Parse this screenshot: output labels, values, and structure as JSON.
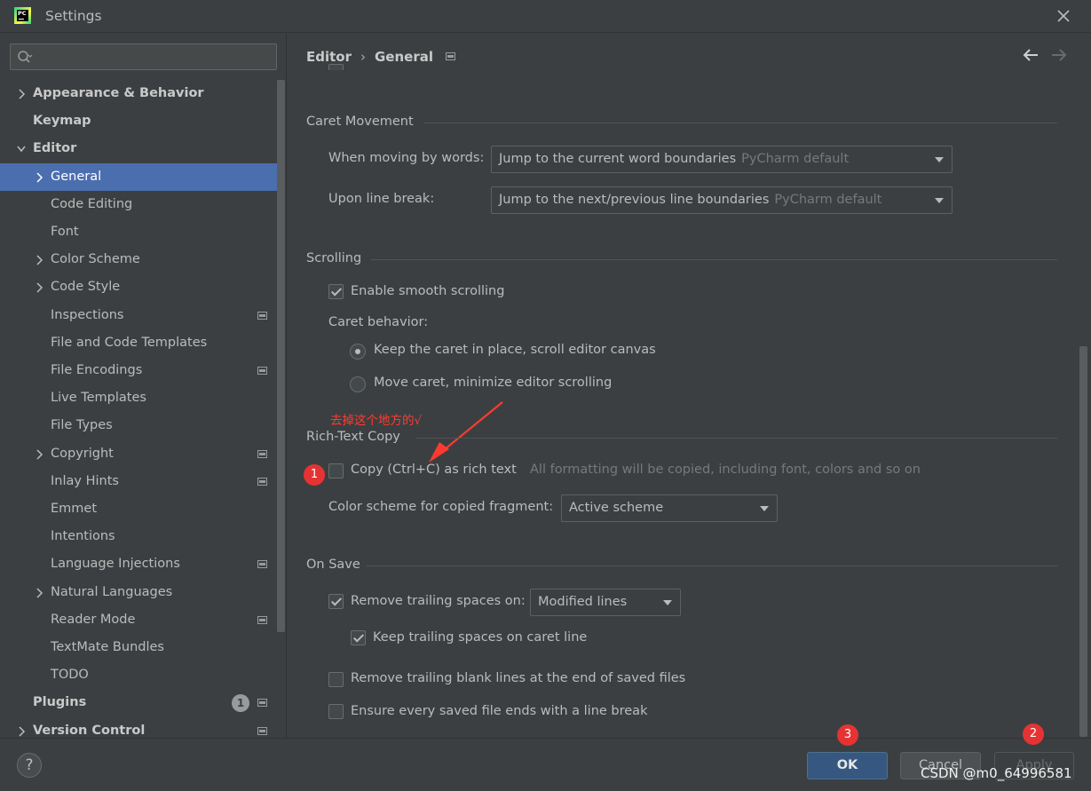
{
  "window": {
    "title": "Settings"
  },
  "search": {
    "placeholder": ""
  },
  "sidebar": {
    "items": [
      {
        "label": "Appearance & Behavior",
        "bold": true,
        "arrow": "right",
        "level": 0
      },
      {
        "label": "Keymap",
        "bold": true,
        "level": 0
      },
      {
        "label": "Editor",
        "bold": true,
        "arrow": "down",
        "level": 0
      },
      {
        "label": "General",
        "arrow": "right",
        "level": 1,
        "selected": true
      },
      {
        "label": "Code Editing",
        "level": 1
      },
      {
        "label": "Font",
        "level": 1
      },
      {
        "label": "Color Scheme",
        "arrow": "right",
        "level": 1
      },
      {
        "label": "Code Style",
        "arrow": "right",
        "level": 1
      },
      {
        "label": "Inspections",
        "level": 1,
        "project": true
      },
      {
        "label": "File and Code Templates",
        "level": 1
      },
      {
        "label": "File Encodings",
        "level": 1,
        "project": true
      },
      {
        "label": "Live Templates",
        "level": 1
      },
      {
        "label": "File Types",
        "level": 1
      },
      {
        "label": "Copyright",
        "arrow": "right",
        "level": 1,
        "project": true
      },
      {
        "label": "Inlay Hints",
        "level": 1,
        "project": true
      },
      {
        "label": "Emmet",
        "level": 1
      },
      {
        "label": "Intentions",
        "level": 1
      },
      {
        "label": "Language Injections",
        "level": 1,
        "project": true
      },
      {
        "label": "Natural Languages",
        "arrow": "right",
        "level": 1
      },
      {
        "label": "Reader Mode",
        "level": 1,
        "project": true
      },
      {
        "label": "TextMate Bundles",
        "level": 1
      },
      {
        "label": "TODO",
        "level": 1
      },
      {
        "label": "Plugins",
        "bold": true,
        "level": 0,
        "badge": "1",
        "project": true
      },
      {
        "label": "Version Control",
        "bold": true,
        "arrow": "right",
        "level": 0,
        "project": true
      }
    ]
  },
  "header": {
    "crumb1": "Editor",
    "crumb2": "General"
  },
  "caret_movement": {
    "title": "Caret Movement",
    "words_label": "When moving by words:",
    "words_value": "Jump to the current word boundaries",
    "words_hint": "PyCharm default",
    "line_break_label": "Upon line break:",
    "line_break_value": "Jump to the next/previous line boundaries",
    "line_break_hint": "PyCharm default"
  },
  "scrolling": {
    "title": "Scrolling",
    "smooth_label": "Enable smooth scrolling",
    "smooth_checked": true,
    "caret_behavior_label": "Caret behavior:",
    "option1": "Keep the caret in place, scroll editor canvas",
    "option2": "Move caret, minimize editor scrolling",
    "selected_option": 1
  },
  "annotation": {
    "text": "去掉这个地方的√",
    "color": "#ff3b30"
  },
  "rich_text": {
    "title": "Rich-Text Copy",
    "copy_label": "Copy (Ctrl+C) as rich text",
    "copy_checked": false,
    "copy_hint": "All formatting will be copied, including font, colors and so on",
    "scheme_label": "Color scheme for copied fragment:",
    "scheme_value": "Active scheme"
  },
  "on_save": {
    "title": "On Save",
    "trailing_label": "Remove trailing spaces on:",
    "trailing_checked": true,
    "trailing_value": "Modified lines",
    "keep_label": "Keep trailing spaces on caret line",
    "keep_checked": true,
    "blank_lines_label": "Remove trailing blank lines at the end of saved files",
    "blank_lines_checked": false,
    "line_break_label": "Ensure every saved file ends with a line break",
    "line_break_checked": false
  },
  "markers": {
    "m1": "1",
    "m2": "2",
    "m3": "3"
  },
  "footer": {
    "help": "?",
    "ok": "OK",
    "cancel": "Cancel",
    "apply": "Apply",
    "watermark": "CSDN @m0_64996581"
  },
  "colors": {
    "selection": "#4b6eaf",
    "ok_button": "#365880",
    "marker": "#e53333"
  }
}
